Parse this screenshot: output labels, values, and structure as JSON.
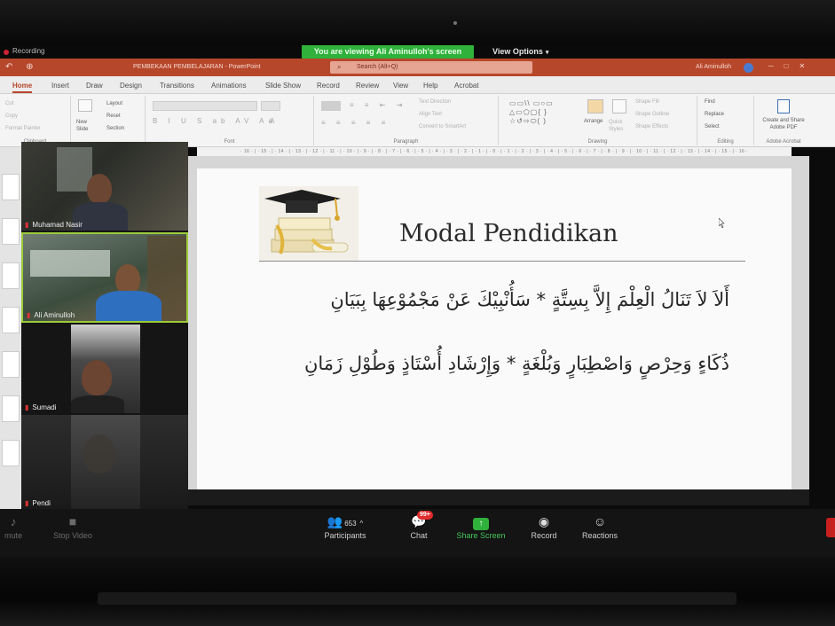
{
  "zoom": {
    "recording_label": "Recording",
    "share_banner": "You are viewing Ali Aminulloh's screen",
    "view_options": "View Options",
    "toolbar": {
      "mute": "mute",
      "stop_video": "Stop Video",
      "participants_label": "Participants",
      "participants_count": "653",
      "chat_label": "Chat",
      "chat_badge": "99+",
      "share_screen_label": "Share Screen",
      "record_label": "Record",
      "reactions_label": "Reactions"
    },
    "participants": [
      {
        "name": "Muhamad Nasir"
      },
      {
        "name": "Ali Aminulloh"
      },
      {
        "name": "Sumadi"
      },
      {
        "name": "Pendi"
      }
    ]
  },
  "powerpoint": {
    "document_title": "PEMBEKAAN PEMBELAJARAN  -  PowerPoint",
    "search_placeholder": "Search (Alt+Q)",
    "user_name": "Ali Aminulloh",
    "tabs": [
      "Home",
      "Insert",
      "Draw",
      "Design",
      "Transitions",
      "Animations",
      "Slide Show",
      "Record",
      "Review",
      "View",
      "Help",
      "Acrobat"
    ],
    "active_tab": "Home",
    "ribbon": {
      "clipboard": {
        "group": "Clipboard",
        "cut": "Cut",
        "copy": "Copy",
        "format_painter": "Format Painter"
      },
      "slides": {
        "new_slide": "New Slide",
        "layout": "Layout",
        "reset": "Reset",
        "section": "Section"
      },
      "font": {
        "group": "Font"
      },
      "paragraph": {
        "group": "Paragraph",
        "text_direction": "Text Direction",
        "align_text": "Align Text",
        "convert_smartart": "Convert to SmartArt"
      },
      "drawing": {
        "group": "Drawing",
        "arrange": "Arrange",
        "quick_styles": "Quick Styles",
        "shape_fill": "Shape Fill",
        "shape_outline": "Shape Outline",
        "shape_effects": "Shape Effects"
      },
      "editing": {
        "group": "Editing",
        "find": "Find",
        "replace": "Replace",
        "select": "Select"
      },
      "acrobat": {
        "group": "Adobe Acrobat",
        "create_share": "Create and Share Adobe PDF"
      }
    },
    "ruler_text": "· 16 · | · 15 · | · 14 · | · 13 · | · 12 · | · 11 · | · 10 · | · 9 · | · 8 · | · 7 · | · 6 · | · 5 · | · 4 · | · 3 · | · 2 · | · 1 · | · 0 · | · 1 · | · 2 · | · 3 · | · 4 · | · 5 · | · 6 · | · 7 · | · 8 · | · 9 · | · 10 · | · 11 · | · 12 · | · 13 · | · 14 · | · 15 · | · 16 ·"
  },
  "slide": {
    "title": "Modal Pendidikan",
    "line1": "أَلاَ لاَ تَنَالُ الْعِلْمَ إِلاَّ بِسِتَّةٍ * سَأُنْبِيْكَ عَنْ مَجْمُوْعِهَا بِبَيَانِ",
    "line2": "ذُكَاءٍ وَحِرْصٍ وَاصْطِبَارٍ وَبُلْغَةٍ * وَإِرْشَادِ أُسْتَاذٍ وَطُوْلِ زَمَانِ"
  },
  "colors": {
    "powerpoint_accent": "#b7472a",
    "zoom_green": "#2fb13c",
    "active_speaker_border": "#9ccb39",
    "chat_badge": "#e02c2c"
  },
  "icons": [
    "recording-dot-icon",
    "participants-icon",
    "chat-icon",
    "share-screen-icon",
    "record-icon",
    "reactions-icon",
    "mic-muted-icon",
    "video-icon",
    "search-icon",
    "graduation-cap-books-image"
  ]
}
